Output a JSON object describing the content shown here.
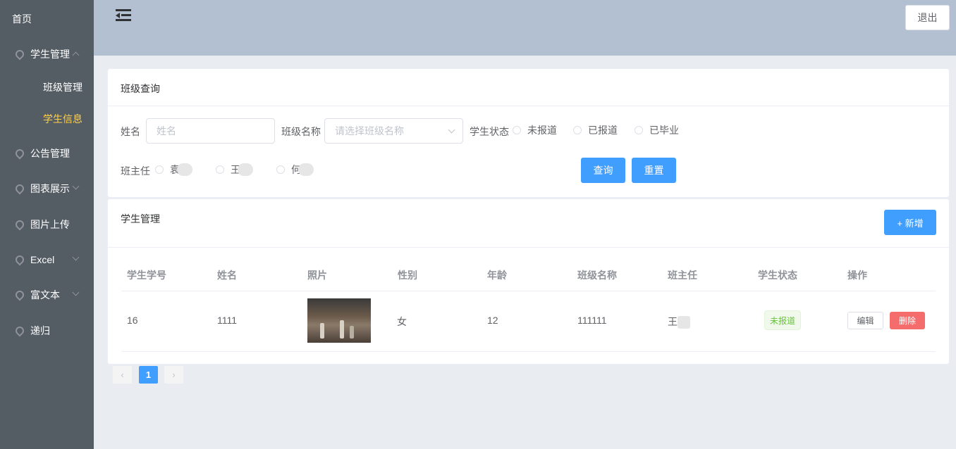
{
  "sidebar": {
    "home": "首页",
    "items": [
      {
        "label": "学生管理",
        "expanded": true
      },
      {
        "label": "公告管理"
      },
      {
        "label": "图表展示",
        "expandable": true
      },
      {
        "label": "图片上传"
      },
      {
        "label": "Excel",
        "expandable": true
      },
      {
        "label": "富文本",
        "expandable": true
      },
      {
        "label": "递归"
      }
    ],
    "sub_items": [
      {
        "label": "班级管理",
        "active": false
      },
      {
        "label": "学生信息",
        "active": true
      }
    ],
    "colors": {
      "bg": "#545c64",
      "active_text": "#ffd04b"
    }
  },
  "header": {
    "logout_label": "退出",
    "bg": "#b3c0d1"
  },
  "query_card": {
    "title": "班级查询",
    "name_label": "姓名",
    "name_placeholder": "姓名",
    "class_label": "班级名称",
    "class_placeholder": "请选择班级名称",
    "status_label": "学生状态",
    "status_options": [
      "未报道",
      "已报道",
      "已毕业"
    ],
    "teacher_label": "班主任",
    "teacher_options": [
      "袁",
      "王",
      "何"
    ],
    "query_button": "查询",
    "reset_button": "重置"
  },
  "student_card": {
    "title": "学生管理",
    "add_button": "+ 新增",
    "columns": [
      "学生学号",
      "姓名",
      "照片",
      "性别",
      "年龄",
      "班级名称",
      "班主任",
      "学生状态",
      "操作"
    ],
    "rows": [
      {
        "id": "16",
        "name": "1111",
        "gender": "女",
        "age": "12",
        "class_name": "111111",
        "teacher": "王",
        "status": "未报道",
        "edit": "编辑",
        "delete": "删除"
      }
    ]
  },
  "pagination": {
    "prev": "‹",
    "current": "1",
    "next": "›"
  },
  "colors": {
    "primary": "#409eff",
    "danger": "#f56c6c",
    "success": "#67c23a"
  }
}
